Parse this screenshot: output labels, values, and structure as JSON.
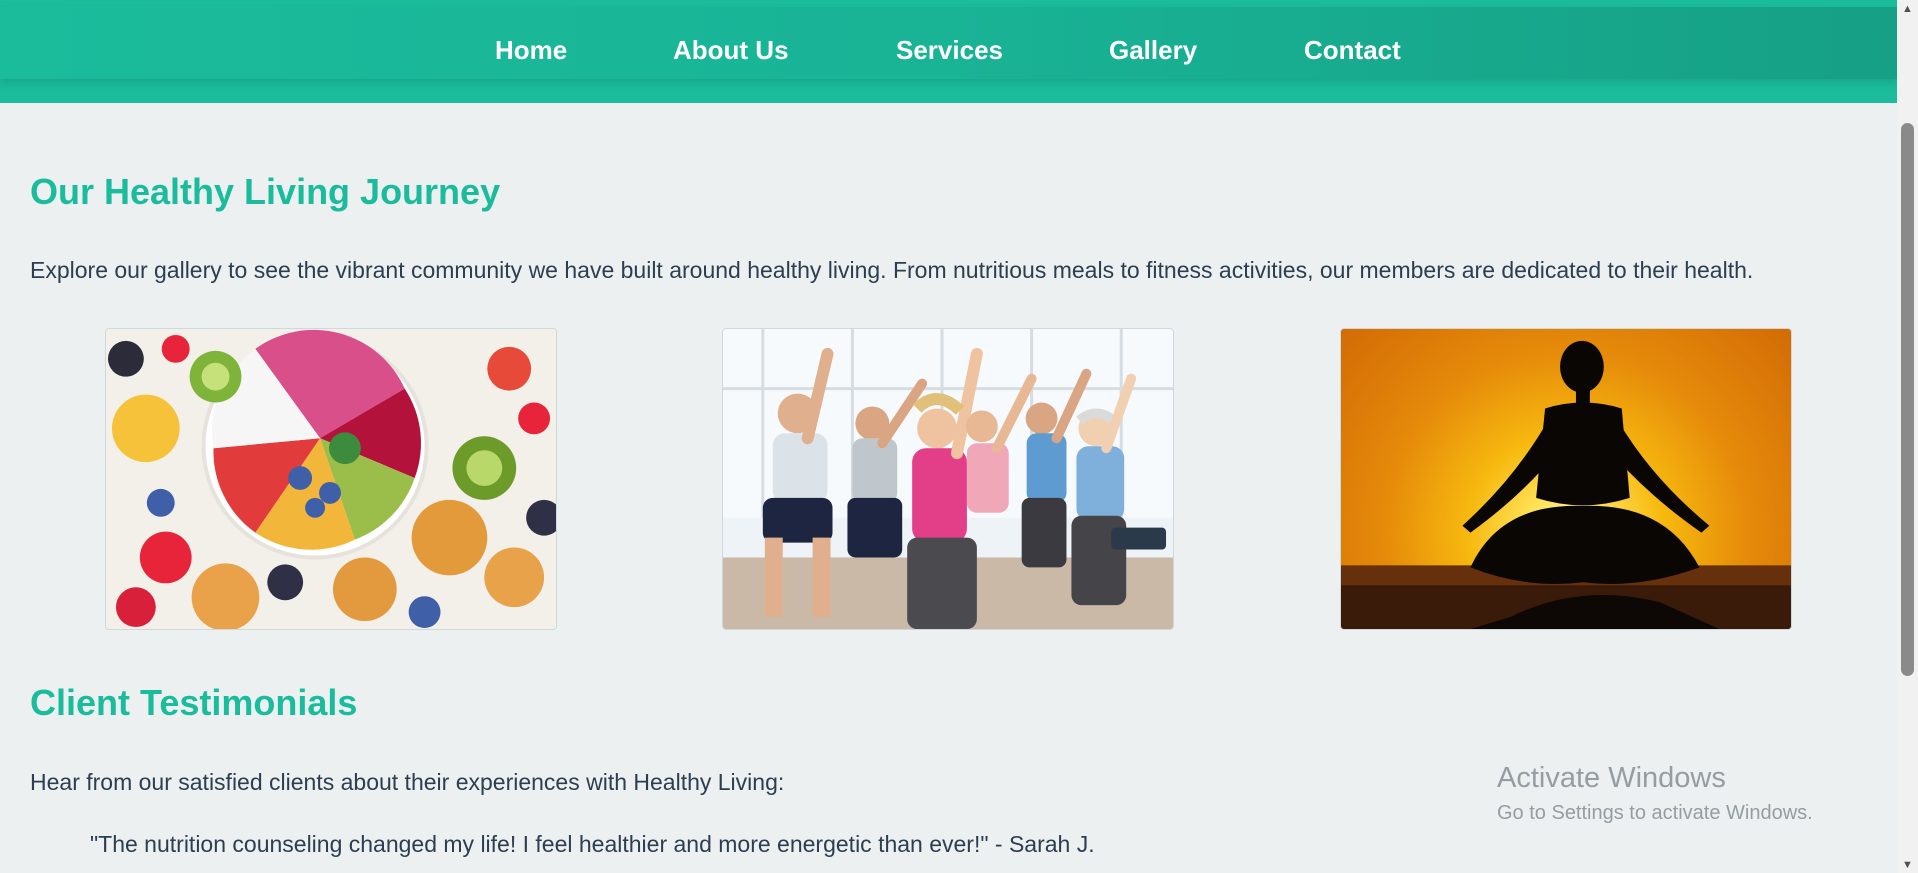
{
  "nav": {
    "home": "Home",
    "about": "About Us",
    "services": "Services",
    "gallery": "Gallery",
    "contact": "Contact"
  },
  "journey": {
    "title": "Our Healthy Living Journey",
    "intro": "Explore our gallery to see the vibrant community we have built around healthy living. From nutritious meals to fitness activities, our members are dedicated to their health."
  },
  "testimonials": {
    "title": "Client Testimonials",
    "intro": "Hear from our satisfied clients about their experiences with Healthy Living:",
    "quote": "\"The nutrition counseling changed my life! I feel healthier and more energetic than ever!\" - Sarah J."
  },
  "watermark": {
    "line1": "Activate Windows",
    "line2": "Go to Settings to activate Windows."
  },
  "colors": {
    "accent": "#1abc9c",
    "accent_dark": "#16a085",
    "text": "#2c3e50",
    "background": "#ecf0f1"
  },
  "icons": {
    "scroll_up": "triangle-up-icon",
    "scroll_down": "triangle-down-icon"
  }
}
